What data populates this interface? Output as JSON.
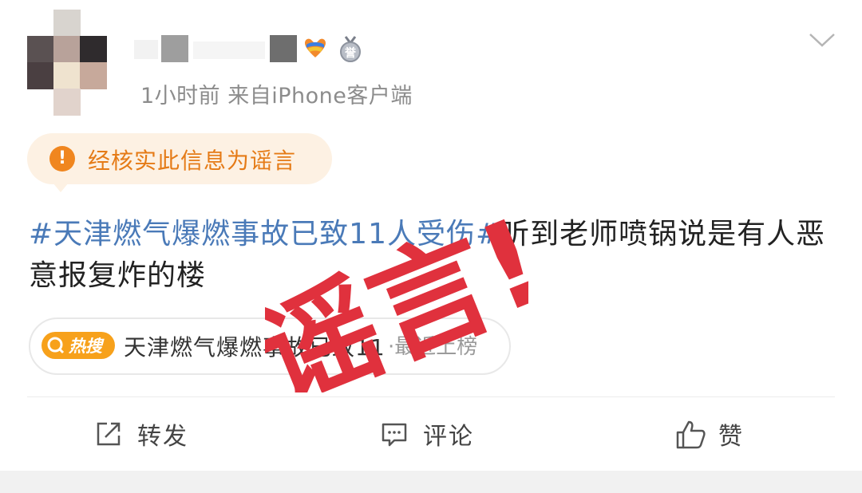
{
  "post": {
    "meta": "1小时前  来自iPhone客户端",
    "notice": "经核实此信息为谣言",
    "notice_icon": "info-icon",
    "content": {
      "topic": "#天津燃气爆燃事故已致11人受伤#",
      "text": "听到老师喷锅说是有人恶意报复炸的楼"
    },
    "hot_search": {
      "badge_label": "热搜",
      "title": "天津燃气爆燃事故已致11",
      "suffix": "·最近上榜"
    },
    "actions": {
      "repost": "转发",
      "comment": "评论",
      "like": "赞"
    },
    "stamp": "谣言!"
  },
  "colors": {
    "topic_link": "#4a7ab8",
    "notice_bg": "#fdf1e3",
    "notice_text": "#e57b17",
    "hot_badge": "#f7a11b",
    "stamp": "#e0313d"
  }
}
